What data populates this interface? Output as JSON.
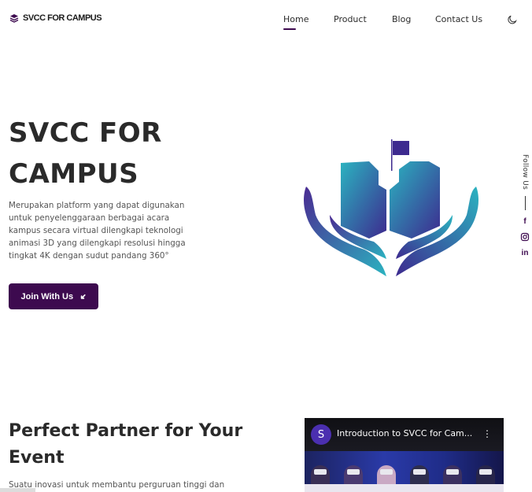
{
  "brand": {
    "name": "SVCC FOR CAMPUS",
    "icon": "layers-icon"
  },
  "nav": {
    "items": [
      {
        "label": "Home",
        "active": true
      },
      {
        "label": "Product"
      },
      {
        "label": "Blog"
      },
      {
        "label": "Contact Us"
      }
    ],
    "theme_toggle_icon": "moon-icon"
  },
  "hero": {
    "title": "SVCC FOR CAMPUS",
    "description": "Merupakan platform yang dapat digunakan untuk penyelenggaraan berbagai acara kampus secara virtual dilengkapi teknologi animasi 3D yang dilengkapi resolusi hingga tingkat 4K dengan sudut pandang 360°",
    "cta_label": "Join With Us",
    "cta_icon": "arrow-down-right-icon",
    "illustration": "hands-holding-campus-icon"
  },
  "follow": {
    "label": "Follow Us",
    "socials": [
      {
        "name": "facebook-icon",
        "glyph": "f"
      },
      {
        "name": "instagram-icon",
        "glyph": ""
      },
      {
        "name": "linkedin-icon",
        "glyph": "in"
      }
    ]
  },
  "section": {
    "title": "Perfect Partner for Your Event",
    "description": "Suatu inovasi untuk membantu perguruan tinggi dan"
  },
  "video": {
    "channel_initial": "S",
    "title": "Introduction to SVCC for Cam...",
    "menu_icon": "more-vertical-icon"
  },
  "colors": {
    "primary": "#3d0a4f",
    "gradient_start": "#2bb3c0",
    "gradient_end": "#3d2a8f"
  }
}
